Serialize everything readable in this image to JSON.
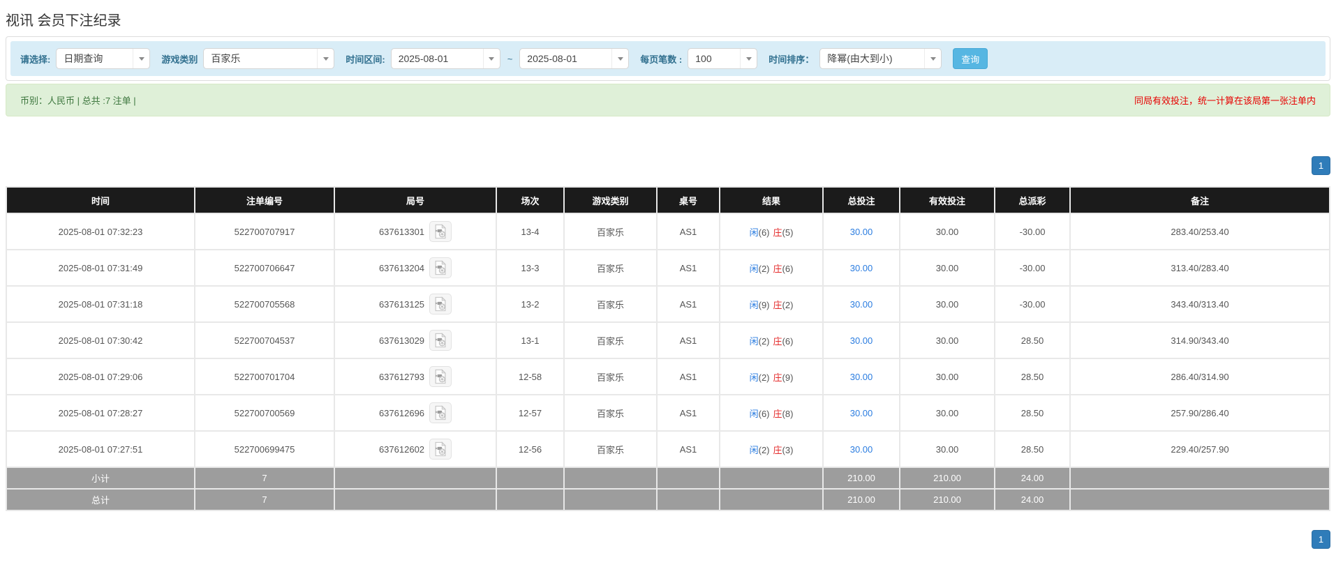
{
  "page": {
    "title": "视讯 会员下注纪录"
  },
  "filters": {
    "select_label": "请选择:",
    "select_value": "日期查询",
    "game_type_label": "游戏类别",
    "game_type_value": "百家乐",
    "time_range_label": "时间区间:",
    "date_from": "2025-08-01",
    "tilde": "~",
    "date_to": "2025-08-01",
    "page_size_label": "每页笔数 :",
    "page_size_value": "100",
    "sort_label": "时间排序：",
    "sort_value": "降幂(由大到小)",
    "search_button": "查询"
  },
  "summary_bar": {
    "left": "币别：人民币 | 总共 :7 注单 |",
    "right": "同局有效投注，统一计算在该局第一张注单内"
  },
  "pagination": {
    "page": "1"
  },
  "icons": {
    "combo_arrow": "chevron-down",
    "round_video": "video-file"
  },
  "colors": {
    "filter_bar_bg": "#d9edf7",
    "filter_label": "#31708f",
    "search_button_bg": "#56b6e2",
    "info_bar_bg": "#dff0d8",
    "info_text_green": "#3c763d",
    "info_text_red": "#e60000",
    "pager_blue": "#2f7cb9",
    "header_bg": "#1b1b1b",
    "summary_row_bg": "#9d9d9d",
    "link_blue": "#2a7ce0",
    "negative_red": "#e42b2b"
  },
  "table": {
    "headers": [
      "时间",
      "注单编号",
      "局号",
      "场次",
      "游戏类别",
      "桌号",
      "结果",
      "总投注",
      "有效投注",
      "总派彩",
      "备注"
    ],
    "rows": [
      {
        "time": "2025-08-01 07:32:23",
        "order_id": "522700707917",
        "round_id": "637613301",
        "session": "13-4",
        "game": "百家乐",
        "table_no": "AS1",
        "result_player": "闲",
        "result_player_num": "(6)",
        "result_banker": "庄",
        "result_banker_num": "(5)",
        "total_bet": "30.00",
        "valid_bet": "30.00",
        "payout": "-30.00",
        "note": "283.40/253.40"
      },
      {
        "time": "2025-08-01 07:31:49",
        "order_id": "522700706647",
        "round_id": "637613204",
        "session": "13-3",
        "game": "百家乐",
        "table_no": "AS1",
        "result_player": "闲",
        "result_player_num": "(2)",
        "result_banker": "庄",
        "result_banker_num": "(6)",
        "total_bet": "30.00",
        "valid_bet": "30.00",
        "payout": "-30.00",
        "note": "313.40/283.40"
      },
      {
        "time": "2025-08-01 07:31:18",
        "order_id": "522700705568",
        "round_id": "637613125",
        "session": "13-2",
        "game": "百家乐",
        "table_no": "AS1",
        "result_player": "闲",
        "result_player_num": "(9)",
        "result_banker": "庄",
        "result_banker_num": "(2)",
        "total_bet": "30.00",
        "valid_bet": "30.00",
        "payout": "-30.00",
        "note": "343.40/313.40"
      },
      {
        "time": "2025-08-01 07:30:42",
        "order_id": "522700704537",
        "round_id": "637613029",
        "session": "13-1",
        "game": "百家乐",
        "table_no": "AS1",
        "result_player": "闲",
        "result_player_num": "(2)",
        "result_banker": "庄",
        "result_banker_num": "(6)",
        "total_bet": "30.00",
        "valid_bet": "30.00",
        "payout": "28.50",
        "note": "314.90/343.40"
      },
      {
        "time": "2025-08-01 07:29:06",
        "order_id": "522700701704",
        "round_id": "637612793",
        "session": "12-58",
        "game": "百家乐",
        "table_no": "AS1",
        "result_player": "闲",
        "result_player_num": "(2)",
        "result_banker": "庄",
        "result_banker_num": "(9)",
        "total_bet": "30.00",
        "valid_bet": "30.00",
        "payout": "28.50",
        "note": "286.40/314.90"
      },
      {
        "time": "2025-08-01 07:28:27",
        "order_id": "522700700569",
        "round_id": "637612696",
        "session": "12-57",
        "game": "百家乐",
        "table_no": "AS1",
        "result_player": "闲",
        "result_player_num": "(6)",
        "result_banker": "庄",
        "result_banker_num": "(8)",
        "total_bet": "30.00",
        "valid_bet": "30.00",
        "payout": "28.50",
        "note": "257.90/286.40"
      },
      {
        "time": "2025-08-01 07:27:51",
        "order_id": "522700699475",
        "round_id": "637612602",
        "session": "12-56",
        "game": "百家乐",
        "table_no": "AS1",
        "result_player": "闲",
        "result_player_num": "(2)",
        "result_banker": "庄",
        "result_banker_num": "(3)",
        "total_bet": "30.00",
        "valid_bet": "30.00",
        "payout": "28.50",
        "note": "229.40/257.90"
      }
    ],
    "subtotal": {
      "label": "小计",
      "count": "7",
      "total_bet": "210.00",
      "valid_bet": "210.00",
      "payout": "24.00"
    },
    "total": {
      "label": "总计",
      "count": "7",
      "total_bet": "210.00",
      "valid_bet": "210.00",
      "payout": "24.00"
    }
  }
}
